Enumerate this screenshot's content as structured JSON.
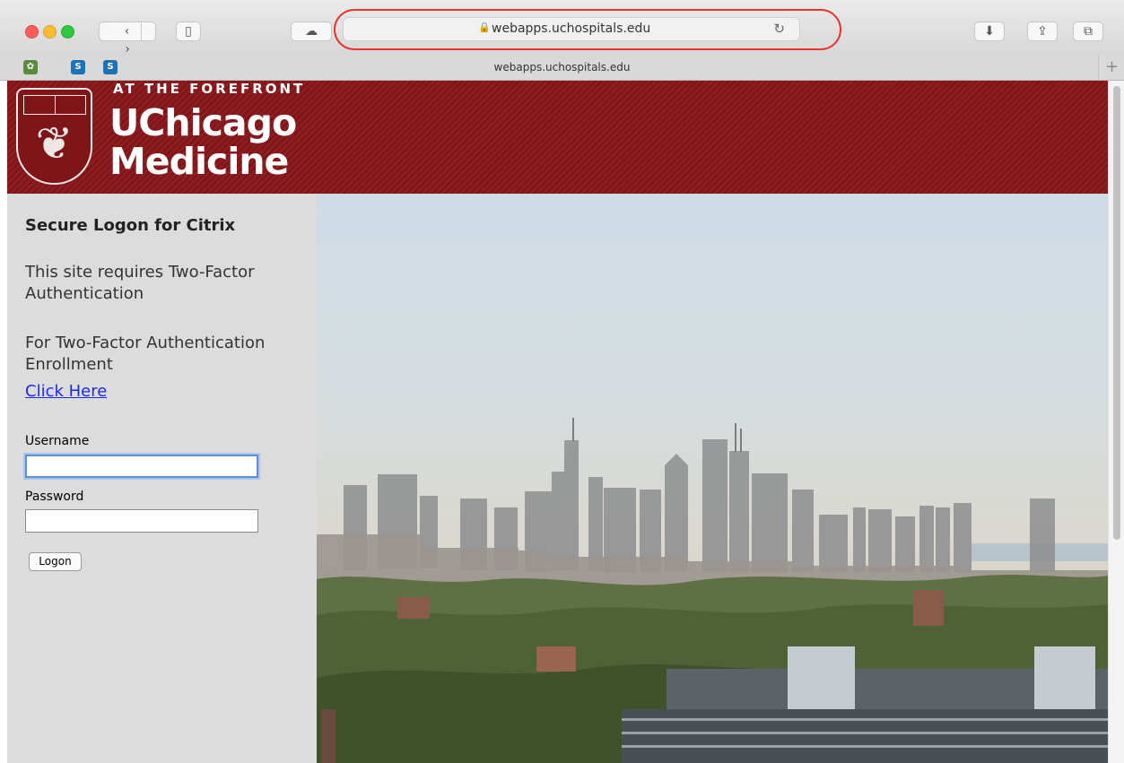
{
  "browser": {
    "address": "webapps.uchospitals.edu",
    "tab_title": "webapps.uchospitals.edu",
    "icons": {
      "back": "‹",
      "forward": "›",
      "sidebar": "▯",
      "shade": "☁",
      "lock": "🔒",
      "reload": "↻",
      "download": "⬇",
      "share": "⇪",
      "tabs": "⧉",
      "new_tab": "+"
    },
    "bookmarks": [
      {
        "icon": "✿"
      },
      {
        "icon": "S"
      },
      {
        "icon": "S"
      }
    ]
  },
  "header": {
    "tagline": "AT THE FOREFRONT",
    "logo_line1": "UChicago",
    "logo_line2": "Medicine",
    "brand_color": "#8e1c20"
  },
  "login": {
    "title": "Secure Logon for Citrix",
    "notice": "This site requires Two-Factor Authentication",
    "enroll_text": "For Two-Factor Authentication Enrollment",
    "enroll_link": "Click Here",
    "username_label": "Username",
    "username_value": "",
    "password_label": "Password",
    "password_value": "",
    "submit_label": "Logon"
  }
}
